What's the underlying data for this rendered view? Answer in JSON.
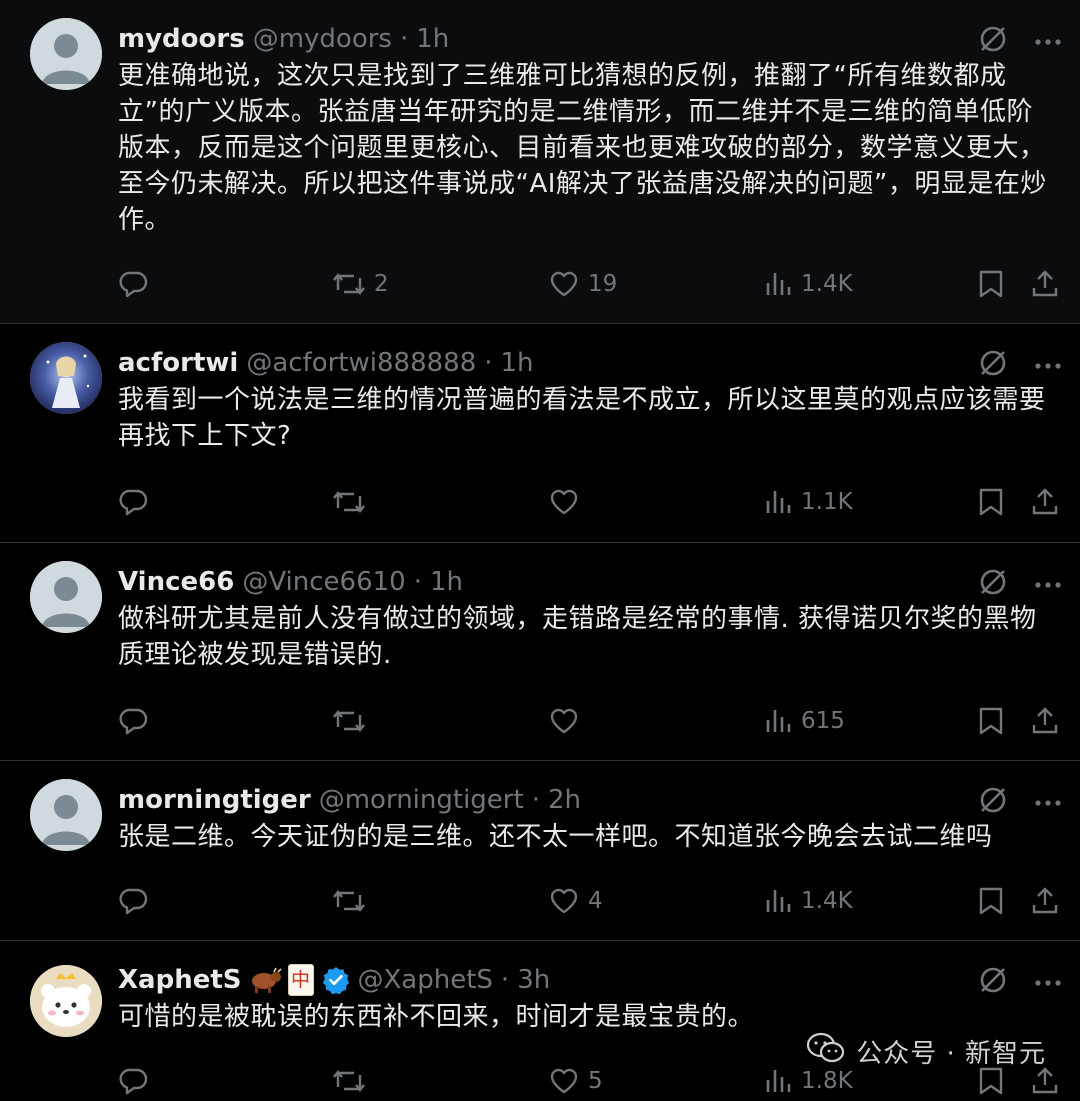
{
  "tweets": [
    {
      "name": "mydoors",
      "handle": "@mydoors",
      "sep": "·",
      "time": "1h",
      "text": "更准确地说，这次只是找到了三维雅可比猜想的反例，推翻了“所有维数都成立”的广义版本。张益唐当年研究的是二维情形，而二维并不是三维的简单低阶版本，反而是这个问题里更核心、目前看来也更难攻破的部分，数学意义更大，至今仍未解决。所以把这件事说成“AI解决了张益唐没解决的问题”，明显是在炒作。",
      "retweets": "2",
      "likes": "19",
      "views": "1.4K"
    },
    {
      "name": "acfortwi",
      "handle": "@acfortwi888888",
      "sep": "·",
      "time": "1h",
      "text": "我看到一个说法是三维的情况普遍的看法是不成立，所以这里莫的观点应该需要再找下上下文?",
      "retweets": "",
      "likes": "",
      "views": "1.1K"
    },
    {
      "name": "Vince66",
      "handle": "@Vince6610",
      "sep": "·",
      "time": "1h",
      "text": "做科研尤其是前人没有做过的领域，走错路是经常的事情. 获得诺贝尔奖的黑物质理论被发现是错误的.",
      "retweets": "",
      "likes": "",
      "views": "615"
    },
    {
      "name": "morningtiger",
      "handle": "@morningtigert",
      "sep": "·",
      "time": "2h",
      "text": "张是二维。今天证伪的是三维。还不太一样吧。不知道张今晚会去试二维吗",
      "retweets": "",
      "likes": "4",
      "views": "1.4K"
    },
    {
      "name": "XaphetS",
      "badge_text": "中",
      "handle": "@XaphetS",
      "sep": "·",
      "time": "3h",
      "text": "可惜的是被耽误的东西补不回来，时间才是最宝贵的。",
      "retweets": "",
      "likes": "5",
      "views": "1.8K"
    }
  ],
  "watermark": {
    "text": "公众号 · 新智元"
  },
  "colors": {
    "background": "#000000",
    "text": "#e7e9ea",
    "muted": "#71767b",
    "divider": "#2f3336",
    "verified": "#1d9bf0"
  },
  "icons": [
    "grok-icon",
    "more-icon",
    "reply-icon",
    "retweet-icon",
    "like-icon",
    "views-icon",
    "bookmark-icon",
    "share-icon",
    "verified-icon",
    "wechat-icon"
  ]
}
